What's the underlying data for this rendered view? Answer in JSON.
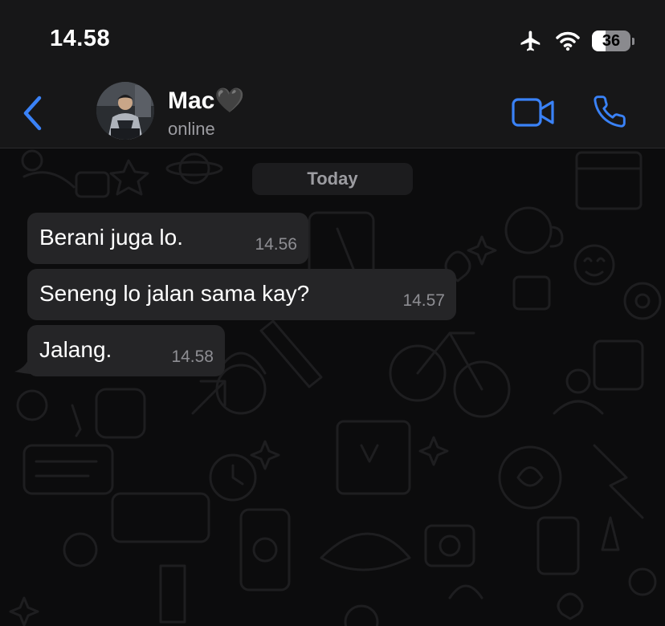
{
  "status_bar": {
    "time": "14.58",
    "battery_level": "36",
    "icons": [
      "airplane-icon",
      "wifi-icon",
      "battery-icon"
    ]
  },
  "header": {
    "contact_name": "Mac🖤",
    "contact_status": "online",
    "icons": [
      "back-chevron-icon",
      "video-call-icon",
      "phone-call-icon"
    ],
    "accent_color": "#3a82f7"
  },
  "chat": {
    "date_label": "Today",
    "messages": [
      {
        "text": "Berani juga lo.",
        "time": "14.56",
        "direction": "incoming"
      },
      {
        "text": "Seneng lo jalan sama kay?",
        "time": "14.57",
        "direction": "incoming"
      },
      {
        "text": "Jalang.",
        "time": "14.58",
        "direction": "incoming"
      }
    ],
    "bubble_color": "#252527",
    "background_color": "#0c0c0d"
  }
}
